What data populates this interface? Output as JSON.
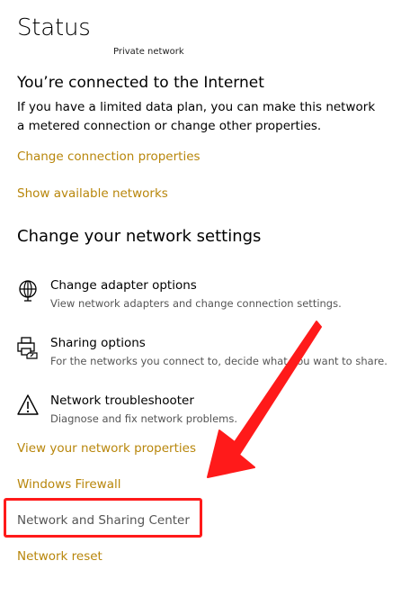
{
  "page": {
    "title": "Status",
    "network_name": "Private network"
  },
  "status": {
    "heading": "You’re connected to the Internet",
    "description": "If you have a limited data plan, you can make this network a metered connection or change other properties."
  },
  "links_top": {
    "change_connection": "Change connection properties",
    "show_networks": "Show available networks"
  },
  "change_settings": {
    "heading": "Change your network settings",
    "items": [
      {
        "title": "Change adapter options",
        "desc": "View network adapters and change connection settings.",
        "icon": "globe-network-icon"
      },
      {
        "title": "Sharing options",
        "desc": "For the networks you connect to, decide what you want to share.",
        "icon": "sharing-printer-icon"
      },
      {
        "title": "Network troubleshooter",
        "desc": "Diagnose and fix network problems.",
        "icon": "warning-triangle-icon"
      }
    ]
  },
  "links_bottom": {
    "view_properties": "View your network properties",
    "firewall": "Windows Firewall",
    "sharing_center": "Network and Sharing Center",
    "reset": "Network reset"
  },
  "colors": {
    "link": "#b8860b",
    "annotation": "#ff1a1a"
  }
}
